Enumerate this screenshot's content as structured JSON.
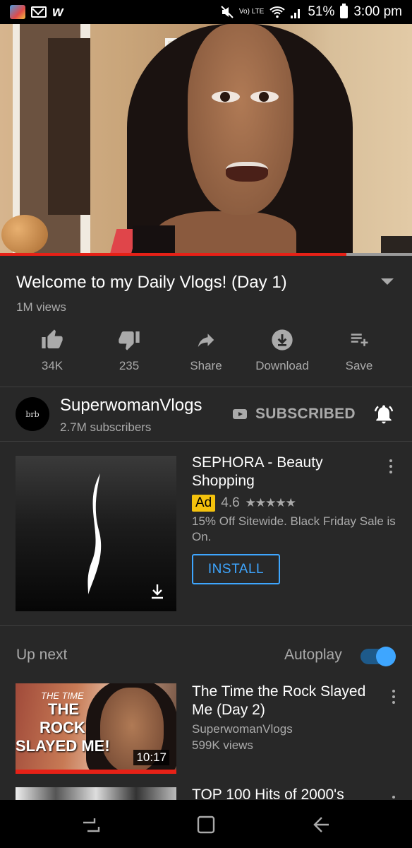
{
  "status_bar": {
    "battery": "51%",
    "time": "3:00 pm",
    "network": "Vo) LTE",
    "icons": [
      "app-icon",
      "mail-icon",
      "w-icon",
      "mute-icon",
      "wifi-icon",
      "signal-icon",
      "battery-icon"
    ],
    "w_glyph": "w"
  },
  "video": {
    "progress": 0.84,
    "colors": {
      "progress": "#e62117",
      "track": "#9a9a9a"
    }
  },
  "details": {
    "title": "Welcome to my Daily Vlogs! (Day 1)",
    "views": "1M views"
  },
  "actions": [
    {
      "label": "34K",
      "icon": "thumbs-up-icon"
    },
    {
      "label": "235",
      "icon": "thumbs-down-icon"
    },
    {
      "label": "Share",
      "icon": "share-icon"
    },
    {
      "label": "Download",
      "icon": "download-icon"
    },
    {
      "label": "Save",
      "icon": "playlist-add-icon"
    }
  ],
  "channel": {
    "avatar_text": "brb",
    "name": "SuperwomanVlogs",
    "subscribers": "2.7M subscribers",
    "subscribe_label": "SUBSCRIBED"
  },
  "ad": {
    "title": "SEPHORA - Beauty Shopping",
    "badge": "Ad",
    "rating": "4.6",
    "stars": "★★★★★",
    "rating_value": 4.6,
    "description": "15% Off Sitewide. Black Friday Sale is On.",
    "button": "INSTALL",
    "colors": {
      "badge": "#f4c20d",
      "install": "#3ea6ff"
    }
  },
  "up_next": {
    "label": "Up next",
    "autoplay_label": "Autoplay",
    "autoplay_on": true
  },
  "next_video": {
    "thumb_text": [
      "THE TIME",
      "THE",
      "ROCK",
      "SLAYED ME!"
    ],
    "duration": "10:17",
    "title": "The Time the Rock Slayed Me (Day 2)",
    "channel": "SuperwomanVlogs",
    "views": "599K views"
  },
  "next_video_2": {
    "title": "TOP 100 Hits of 2000's"
  },
  "nav": {
    "icons": [
      "recent-apps-icon",
      "home-icon",
      "back-icon"
    ]
  }
}
